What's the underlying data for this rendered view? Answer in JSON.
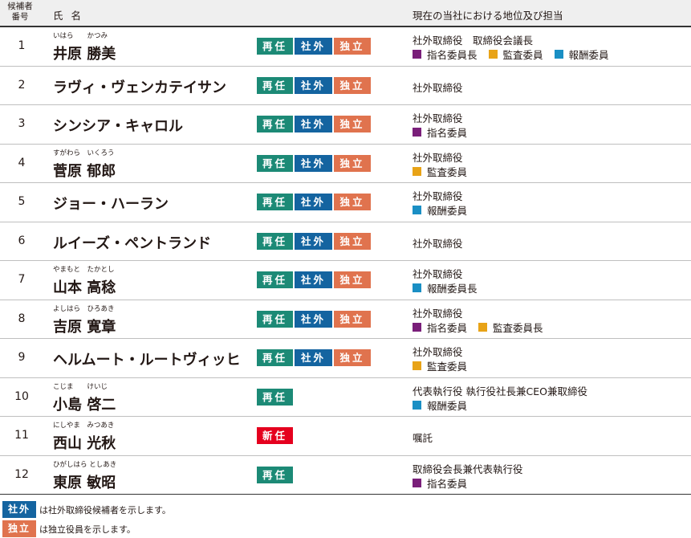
{
  "header": {
    "num_line1": "候補者",
    "num_line2": "番号",
    "name": "氏 名",
    "role": "現在の当社における地位及び担当"
  },
  "badge_labels": {
    "reappoint": "再任",
    "new": "新任",
    "outside": "社外",
    "independent": "独立"
  },
  "committee_colors": {
    "nomination": "#7a1f7a",
    "audit": "#e8a317",
    "compensation": "#1a8fc4"
  },
  "candidates": [
    {
      "num": "1",
      "ruby": "いはら　　かつみ",
      "name": "井原 勝美",
      "role_lines": [
        "社外取締役　取締役会議長"
      ],
      "committees": [
        {
          "label": "指名委員長",
          "color": "#7a1f7a"
        },
        {
          "label": "監査委員",
          "color": "#e8a317"
        },
        {
          "label": "報酬委員",
          "color": "#1a8fc4"
        }
      ]
    },
    {
      "num": "2",
      "ruby": "",
      "name": "ラヴィ・ヴェンカテイサン",
      "role_lines": [
        "社外取締役"
      ],
      "committees": []
    },
    {
      "num": "3",
      "ruby": "",
      "name": "シンシア・キャロル",
      "role_lines": [
        "社外取締役"
      ],
      "committees": [
        {
          "label": "指名委員",
          "color": "#7a1f7a"
        }
      ]
    },
    {
      "num": "4",
      "ruby": "すがわら　いくろう",
      "name": "菅原 郁郎",
      "role_lines": [
        "社外取締役"
      ],
      "committees": [
        {
          "label": "監査委員",
          "color": "#e8a317"
        }
      ]
    },
    {
      "num": "5",
      "ruby": "",
      "name": "ジョー・ハーラン",
      "role_lines": [
        "社外取締役"
      ],
      "committees": [
        {
          "label": "報酬委員",
          "color": "#1a8fc4"
        }
      ]
    },
    {
      "num": "6",
      "ruby": "",
      "name": "ルイーズ・ペントランド",
      "role_lines": [
        "社外取締役"
      ],
      "committees": []
    },
    {
      "num": "7",
      "ruby": "やまもと　たかとし",
      "name": "山本 高稔",
      "role_lines": [
        "社外取締役"
      ],
      "committees": [
        {
          "label": "報酬委員長",
          "color": "#1a8fc4"
        }
      ]
    },
    {
      "num": "8",
      "ruby": "よしはら　ひろあき",
      "name": "吉原 寛章",
      "role_lines": [
        "社外取締役"
      ],
      "committees": [
        {
          "label": "指名委員",
          "color": "#7a1f7a"
        },
        {
          "label": "監査委員長",
          "color": "#e8a317"
        }
      ]
    },
    {
      "num": "9",
      "ruby": "",
      "name": "ヘルムート・ルートヴィッヒ",
      "role_lines": [
        "社外取締役"
      ],
      "committees": [
        {
          "label": "監査委員",
          "color": "#e8a317"
        }
      ]
    },
    {
      "num": "10",
      "ruby": "こじま　　けいじ",
      "name": "小島 啓二",
      "role_lines": [
        "代表執行役 執行役社長兼CEO兼取締役"
      ],
      "committees": [
        {
          "label": "報酬委員",
          "color": "#1a8fc4"
        }
      ]
    },
    {
      "num": "11",
      "ruby": "にしやま　みつあき",
      "name": "西山 光秋",
      "role_lines": [
        "嘱託"
      ],
      "committees": []
    },
    {
      "num": "12",
      "ruby": "ひがしはら としあき",
      "name": "東原 敏昭",
      "role_lines": [
        "取締役会長兼代表執行役"
      ],
      "committees": [
        {
          "label": "指名委員",
          "color": "#7a1f7a"
        }
      ]
    }
  ],
  "legend": {
    "outside_label": "社外",
    "outside_text": "は社外取締役候補者を示します。",
    "independent_label": "独立",
    "independent_text": "は独立役員を示します。"
  }
}
